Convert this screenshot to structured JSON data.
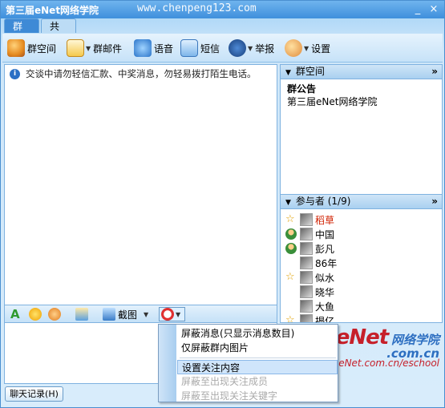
{
  "window": {
    "title": "第三届eNet网络学院",
    "watermark": "www.chenpeng123.com",
    "minimize": "_",
    "close": "×"
  },
  "tabs": [
    {
      "label": "群聊"
    },
    {
      "label": "共享"
    }
  ],
  "toolbar": {
    "items": [
      {
        "label": "群空间",
        "icon": "group-space-icon"
      },
      {
        "label": "群邮件",
        "icon": "mail-icon"
      },
      {
        "label": "语音",
        "icon": "voice-icon"
      },
      {
        "label": "短信",
        "icon": "sms-icon"
      },
      {
        "label": "举报",
        "icon": "report-icon"
      },
      {
        "label": "设置",
        "icon": "settings-icon"
      }
    ]
  },
  "chat": {
    "notice": "交谈中请勿轻信汇款、中奖消息，勿轻易拨打陌生电话。"
  },
  "editor_toolbar": {
    "screenshot_label": "截图"
  },
  "history_button": "聊天记录(H)",
  "group_space": {
    "header": "群空间",
    "more": "»",
    "announcement_title": "群公告",
    "announcement_body": "第三届eNet网络学院"
  },
  "members": {
    "header": "参与者 (1/9)",
    "more": "»",
    "list": [
      {
        "name": "稻草",
        "role": "star",
        "highlight": true
      },
      {
        "name": "中国",
        "role": "user",
        "highlight": false
      },
      {
        "name": "彭凡",
        "role": "user",
        "highlight": false
      },
      {
        "name": "86年",
        "role": "none",
        "highlight": false
      },
      {
        "name": "似水",
        "role": "star",
        "highlight": false
      },
      {
        "name": "晓华",
        "role": "none",
        "highlight": false
      },
      {
        "name": "大鱼",
        "role": "none",
        "highlight": false
      },
      {
        "name": "揭亿",
        "role": "star",
        "highlight": false
      }
    ]
  },
  "context_menu": {
    "items": [
      {
        "label": "屏蔽消息(只显示消息数目)",
        "disabled": false
      },
      {
        "label": "仅屏蔽群内图片",
        "disabled": false
      },
      {
        "label": "设置关注内容",
        "disabled": false,
        "highlighted": true
      },
      {
        "label": "屏蔽至出现关注成员",
        "disabled": true
      },
      {
        "label": "屏蔽至出现关注关键字",
        "disabled": true
      }
    ]
  },
  "brand_watermark": {
    "big": "eNet",
    "cn": "网络学院",
    "domain": ".com.cn",
    "url": "www.eNet.com.cn/eschool"
  },
  "colors": {
    "title_bar": "#3f8fdc",
    "highlight_member": "#d02000",
    "watermark_red": "#c6202a",
    "watermark_blue": "#2d6fc1"
  }
}
